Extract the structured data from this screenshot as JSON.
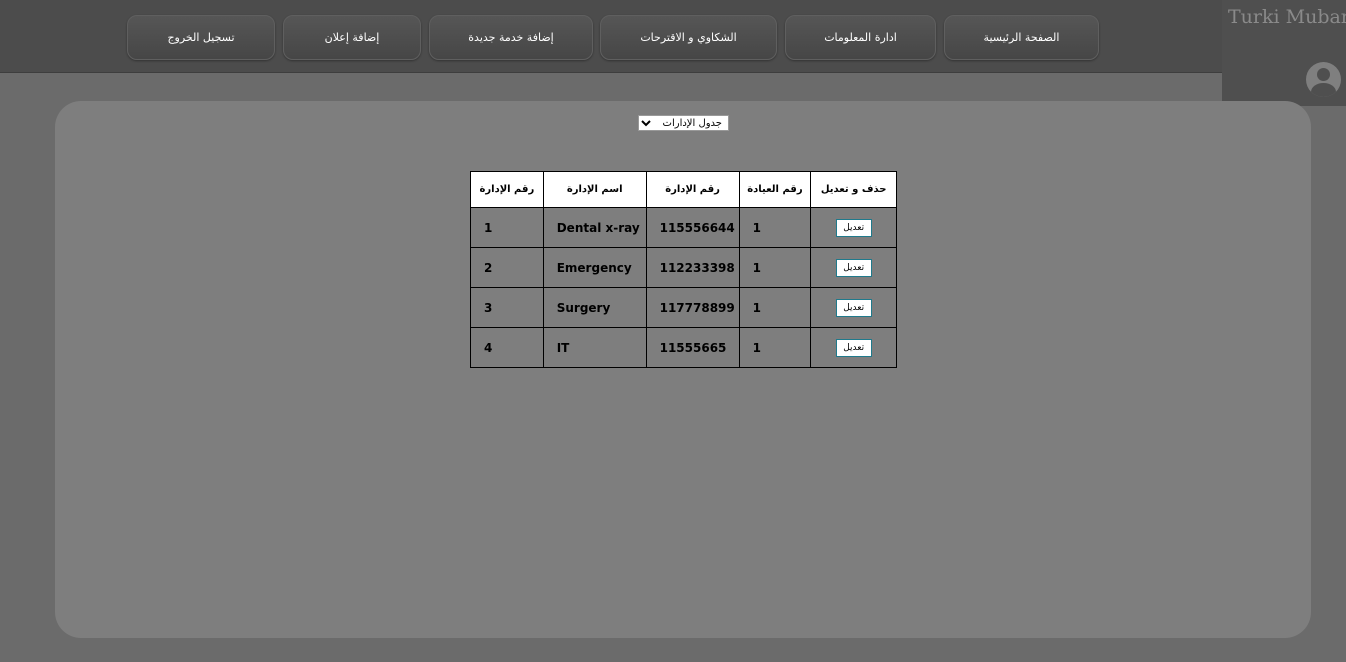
{
  "nav": {
    "home": "الصفحة الرئيسية",
    "info_management": "ادارة المعلومات",
    "complaints": "الشكاوي و الاقترحات",
    "add_service": "إضافة خدمة جديدة",
    "add_ad": "إضافة إعلان",
    "logout": "تسجيل الخروج"
  },
  "user": {
    "name": "Turki Mubark",
    "avatar_icon": "user-avatar-icon"
  },
  "table_select": {
    "selected": "جدول الإدارات",
    "options": [
      "جدول الإدارات"
    ]
  },
  "table": {
    "headers": [
      "رقم الإدارة",
      "اسم الإدارة",
      "رقم الإدارة",
      "رقم العيادة",
      "حذف و تعديل"
    ],
    "rows": [
      {
        "id": "1",
        "name": "Dental x-ray",
        "number": "115556644",
        "clinic": "1",
        "action": "تعديل"
      },
      {
        "id": "2",
        "name": "Emergency",
        "number": "112233398",
        "clinic": "1",
        "action": "تعديل"
      },
      {
        "id": "3",
        "name": "Surgery",
        "number": "117778899",
        "clinic": "1",
        "action": "تعديل"
      },
      {
        "id": "4",
        "name": "IT",
        "number": "11555665",
        "clinic": "1",
        "action": "تعديل"
      }
    ]
  },
  "colors": {
    "background": "#6b6b6b",
    "topbar": "#4c4c4c",
    "panel": "#7e7e7e",
    "button_border": "#1f7a8c"
  }
}
